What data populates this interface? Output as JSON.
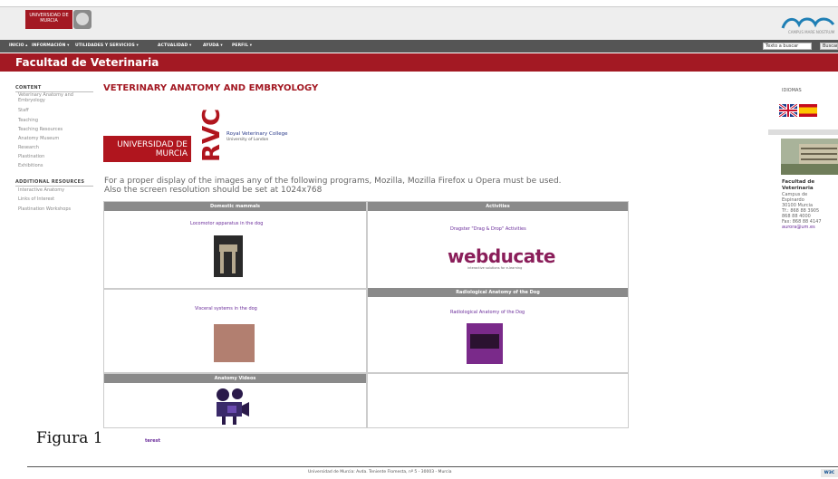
{
  "header": {
    "university_logo": "UNIVERSIDAD DE MURCIA",
    "campus_logo_text": "CAMPUS MARE NOSTRUM"
  },
  "nav": {
    "items": [
      "INICIO ▴",
      "INFORMACIÓN ▾",
      "UTILIDADES Y SERVICIOS ▾",
      "ACTUALIDAD ▾",
      "AYUDA ▾",
      "PERFIL ▾"
    ],
    "search_placeholder": "Texto a buscar",
    "search_button": "Buscar"
  },
  "faculty_title": "Facultad de Veterinaria",
  "sidebar": {
    "content_heading": "CONTENT",
    "content_items": [
      "Veterinary Anatomy and",
      "Embryology",
      "Staff",
      "Teaching",
      "Teaching Resources",
      "Anatomy Museum",
      "Research",
      "Plastination",
      "Exhibitions"
    ],
    "resources_heading": "ADDITIONAL RESOURCES",
    "resources_items": [
      "Interactive Anatomy",
      "Links of Interest",
      "Plastination Workshops"
    ]
  },
  "main": {
    "title": "VETERINARY ANATOMY AND EMBRYOLOGY",
    "um_logo": "UNIVERSIDAD DE MURCIA",
    "rvc_mark": "RVC",
    "rvc_line1": "Royal Veterinary College",
    "rvc_line2": "University of London",
    "note_line1": "For a proper display of the images any of the following programs, Mozilla, Mozilla Firefox u Opera must be used.",
    "note_line2": "Also the screen resolution should be set at 1024x768"
  },
  "grid": {
    "domestic_header": "Domestic mammals",
    "activities_header": "Activities",
    "locomotor_link": "Locomotor apparatus in the dog",
    "dragster_link": "Dragster \"Drag & Drop\" Activities",
    "webducate_logo": "webducate",
    "webducate_tagline": "interactive solutions for e-learning",
    "radiological_header": "Radiological Anatomy of the Dog",
    "visceral_link": "Visceral systems in the dog",
    "radiological_link": "Radiological Anatomy of the Dog",
    "videos_header": "Anatomy Videos"
  },
  "figure_caption": "Figura 1",
  "interest_link": "terest",
  "right_sidebar": {
    "languages_label": "IDIOMAS",
    "contact_title_1": "Facultad de",
    "contact_title_2": "Veterinaria",
    "contact_lines": [
      "Campus de",
      "Espinardo",
      "30100 Murcia",
      "Tf.: 868 88 3905",
      "868 88 4000",
      "Fax: 868 88 4147",
      "aurora@um.es"
    ]
  },
  "footer": {
    "text": "Universidad de Murcia: Avda. Teniente Flomesta, nº 5 - 30003 - Murcia",
    "badge": "W3C"
  },
  "colors": {
    "brand_red": "#a31923",
    "nav_gray": "#555555",
    "link_purple": "#6a2c9a",
    "cell_header_gray": "#8a8a8a"
  }
}
